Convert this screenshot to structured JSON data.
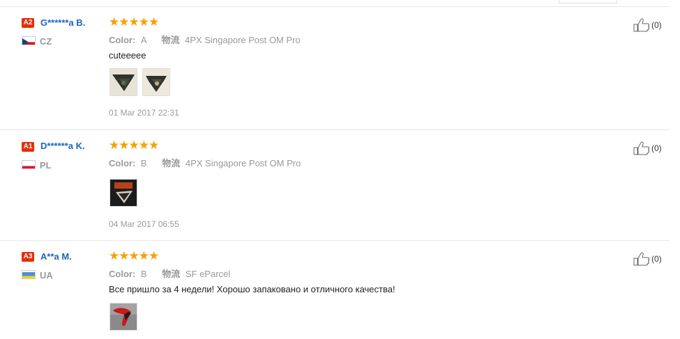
{
  "reviews": [
    {
      "level": "A2",
      "name": "G******a B.",
      "country": "CZ",
      "stars": "★★★★★",
      "color_label": "Color:",
      "color_value": "A",
      "logistics_label": "物流",
      "logistics_value": "4PX Singapore Post OM Pro",
      "text": "cuteeeee",
      "date": "01 Mar 2017 22:31",
      "helpful_count": "(0)",
      "photos": [
        "bandana-photo-1",
        "bandana-photo-2"
      ]
    },
    {
      "level": "A1",
      "name": "D******a K.",
      "country": "PL",
      "stars": "★★★★★",
      "color_label": "Color:",
      "color_value": "B",
      "logistics_label": "物流",
      "logistics_value": "4PX Singapore Post OM Pro",
      "text": "",
      "date": "04 Mar 2017 06:55",
      "helpful_count": "(0)",
      "photos": [
        "bandana-photo-3"
      ]
    },
    {
      "level": "A3",
      "name": "A**a M.",
      "country": "UA",
      "stars": "★★★★★",
      "color_label": "Color:",
      "color_value": "B",
      "logistics_label": "物流",
      "logistics_value": "SF eParcel",
      "text": "Все пришло за 4 недели! Хорошо запаковано и отличного качества!",
      "date": "",
      "helpful_count": "(0)",
      "photos": [
        "bandana-photo-4"
      ]
    }
  ],
  "colors": {
    "name_blue": "#1a66b8",
    "level_badge": "#e62e04",
    "star": "#f7a000",
    "muted": "#999999"
  },
  "icons": {
    "helpful": "thumbs-up-icon"
  }
}
